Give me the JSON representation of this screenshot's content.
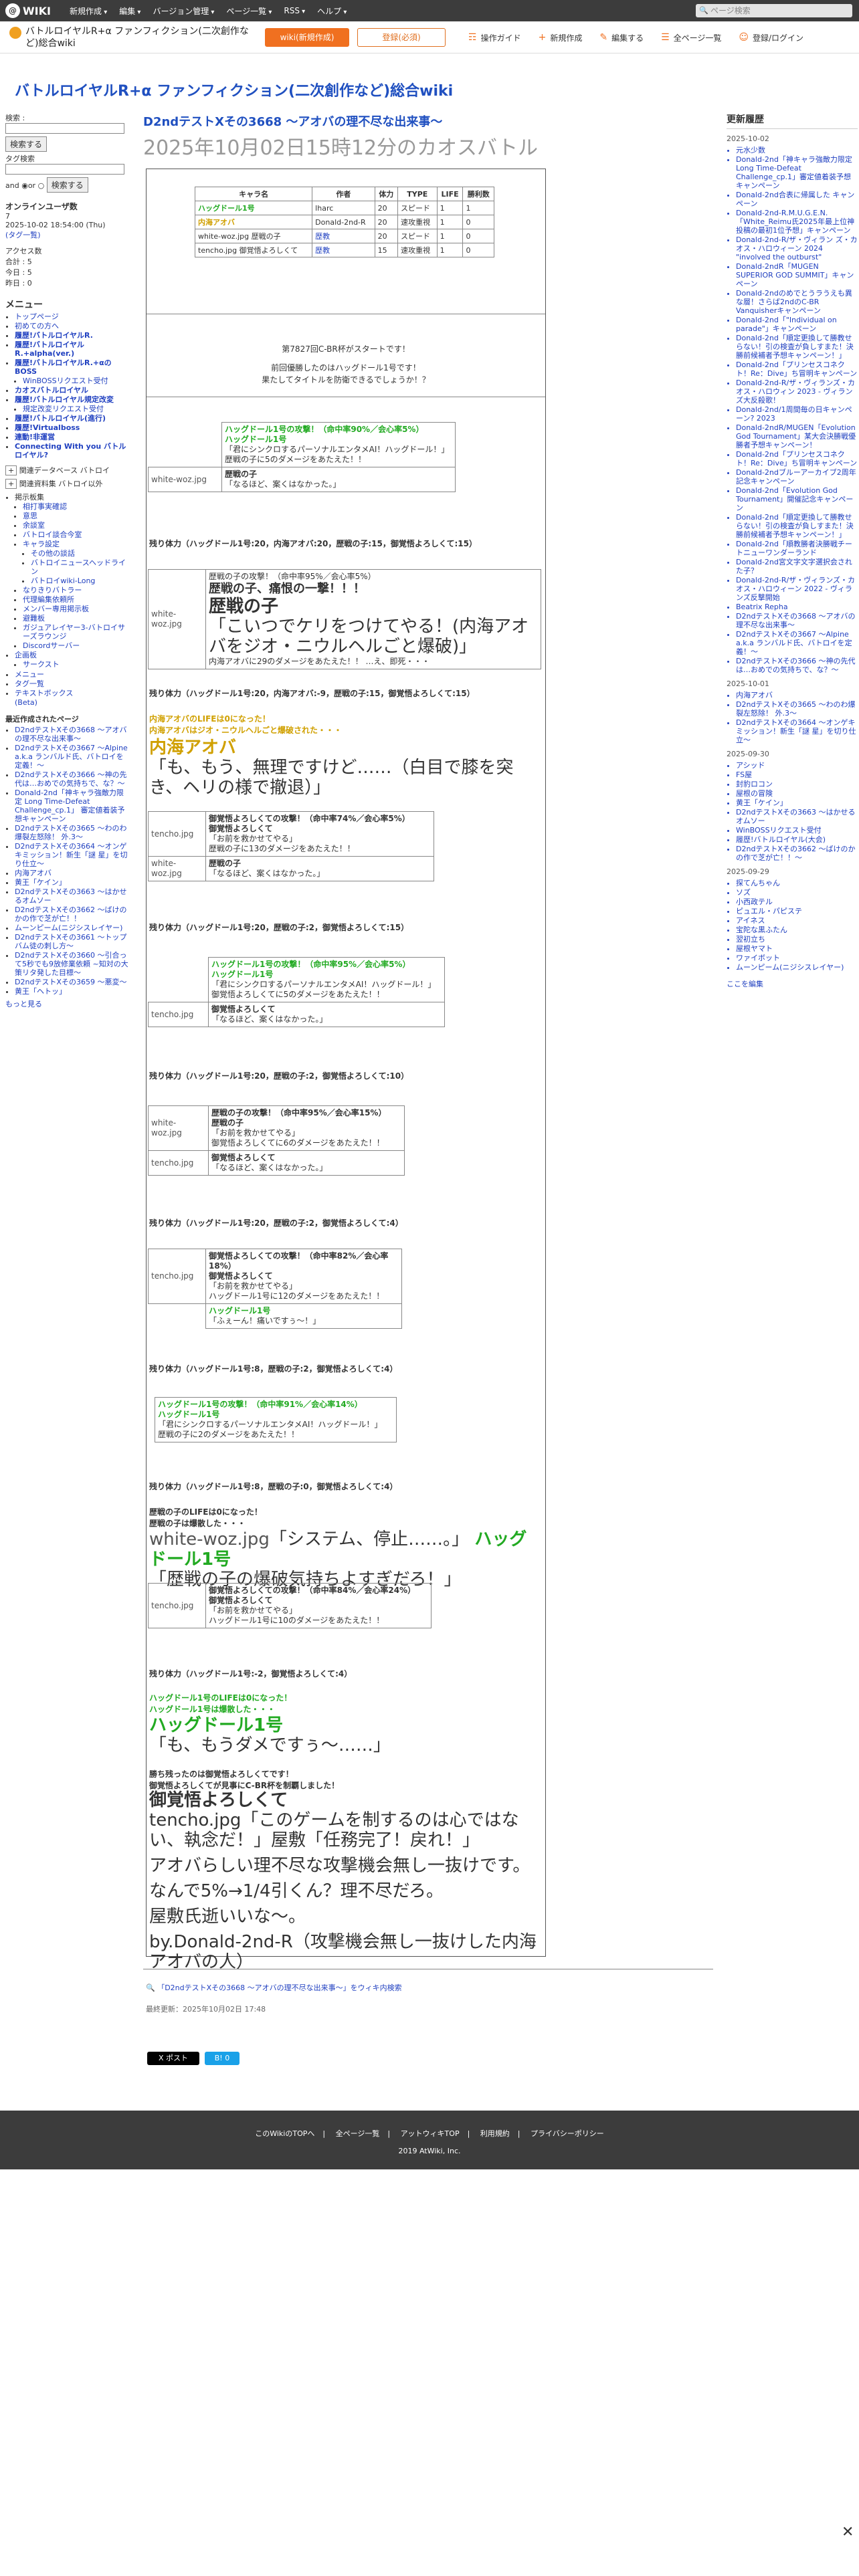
{
  "topbar": {
    "logo": "WIKI",
    "menu": [
      "新規作成",
      "編集",
      "バージョン管理",
      "ページ一覧",
      "RSS",
      "ヘルプ"
    ],
    "search_placeholder": "ページ検索"
  },
  "subbar": {
    "site": "バトルロイヤルR+α ファンフィクション(二次創作など)総合wiki",
    "btn_wiki": "wiki(新規作成)",
    "btn_reg": "登録(必須)",
    "actions": [
      "操作ガイド",
      "新規作成",
      "編集する",
      "全ページ一覧",
      "登録/ログイン"
    ]
  },
  "heading": "バトルロイヤルR+α ファンフィクション(二次創作など)総合wiki",
  "left": {
    "search_label": "検索 :",
    "btn_search": "検索する",
    "tag_label": "タグ検索",
    "and": "and",
    "or": "or",
    "btn_search2": "検索する",
    "online_title": "オンラインユーザ数",
    "online": [
      "7",
      "2025-10-02 18:54:00 (Thu)"
    ],
    "tags_link": "(タグ一覧)",
    "access_title": "アクセス数",
    "access": [
      "合計 : 5",
      "今日 : 5",
      "昨日 : 0"
    ],
    "menu_title": "メニュー",
    "menu_items": [
      "トップページ",
      "初めての方へ",
      "履歴!バトルロイヤルR.",
      "履歴!バトルロイヤルR.+alpha(ver.)",
      "履歴!バトルロイヤルR.+αのBOSS",
      "WinBOSSリクエスト受付",
      "カオスバトルロイヤル",
      "履歴!バトルロイヤル規定改変",
      "規定改変リクエスト受付",
      "履歴!バトルロイヤル(進行)",
      "履歴!Virtualboss",
      "連動!非運営"
    ],
    "menu_items2": [
      "Connecting With you バトルロイヤル?"
    ],
    "sub1": "関連データベース バトロイ",
    "sub2": "関連資料集 バトロイ以外",
    "tree": [
      "掲示板集",
      "相打事実確認",
      "意思",
      "余談室",
      "バトロイ談合今室",
      "キャラ設定",
      "その他の談話",
      "バトロイニュースヘッドライン",
      "バトロイwiki-Long",
      "なりきりバトラー",
      "代理編集依頼所",
      "メンバー専用掲示板",
      "避難板",
      "ガジュアレイヤー3-バトロイサーズラウンジ",
      "Discordサーバー",
      "企画板",
      "サークスト"
    ],
    "other": [
      "メニュー",
      "タグ一覧",
      "テキストボックス",
      "(Beta)"
    ],
    "recent_title": "最近作成されたページ",
    "recent": [
      "D2ndテストXその3668 〜アオバの理不尽な出来事〜",
      "D2ndテストXその3667 〜Alpine a.k.a ランバルド氏、バトロイを定義！〜",
      "D2ndテストXその3666 〜神の先代は…おめでの気持ちで、な？〜",
      "Donald-2nd「神キャラ強敵力限定 Long Time-Defeat Challenge_cp.1」 審定値着装予想キャンペーン",
      "D2ndテストXその3665 〜わのわ爆裂左怒除！ 外.3〜",
      "D2ndテストXその3664 〜オンゲキミッション！新生「謎 星」を切り仕立〜",
      "内海アオバ",
      "黄王「ケイン」",
      "D2ndテストXその3663 〜はかせるオムソー",
      "D2ndテストXその3662 〜ばけのかの作で芝が亡！！",
      "ムーンピーム(ニジシスレイヤー)",
      "D2ndテストXその3661 〜トップバム徒の刺し方〜",
      "D2ndテストXその3660 〜引合って5秒でも9放修業依頼 ~知対の大策リタ発した目標〜",
      "D2ndテストXその3659 〜悪変〜",
      "黄王「ヘトッ」"
    ],
    "more": "もっと見る"
  },
  "main": {
    "title1": "D2ndテストXその3668 〜アオバの理不尽な出来事〜",
    "title2": "2025年10月02日15時12分のカオスバトル",
    "roster_head": [
      "キャラ名",
      "作者",
      "体力",
      "TYPE",
      "LIFE",
      "勝利数"
    ],
    "roster": [
      [
        "ハッグドール1号",
        "lharc",
        "20",
        "スピード",
        "1",
        "1"
      ],
      [
        "内海アオバ",
        "Donald-2nd-R",
        "20",
        "速攻重視",
        "1",
        "0"
      ],
      [
        "white-woz.jpg 歴戦の子",
        "歴教",
        "20",
        "スピード",
        "1",
        "0"
      ],
      [
        "tencho.jpg 御覚悟よろしくて",
        "歴教",
        "15",
        "速攻重視",
        "1",
        "0"
      ]
    ],
    "start": [
      "第7827回C-BR杯がスタートです！",
      "前回優勝したのはハッグドール1号です！",
      "果たしてタイトルを防衛できるでしょうか！？"
    ],
    "a1": [
      "ハッグドール1号の攻撃！（命中率90%／会心率5%）",
      "ハッグドール1号",
      "「君にシンクロするパーソナルエンタメAI！ハッグドール！」",
      "歴戦の子に5のダメージをあたえた！！"
    ],
    "a1b": [
      "white-woz.jpg",
      "歴戦の子",
      "「なるほど、案くはなかった。」"
    ],
    "rem1": "残り体力（ハッグドール1号:20，内海アオバ:20，歴戦の子:15，御覚悟よろしくて:15）",
    "a2": [
      "歴戦の子の攻撃！（命中率95%／会心率5%）",
      "歴戦の子、痛恨の一撃！！！",
      "歴戦の子",
      "「こいつでケリをつけてやる！(内海アオバをジオ・ニウルヘルごと爆破)」",
      "内海アオバに29のダメージをあたえた！！ …え、即死・・・"
    ],
    "a2img": "white-woz.jpg",
    "rem2": "残り体力（ハッグドール1号:20，内海アオバ:-9，歴戦の子:15，御覚悟よろしくて:15）",
    "death1": [
      "内海アオバのLIFEは0になった！",
      "内海アオバはジオ・ニウルヘルごと爆破された・・・"
    ],
    "death1name": "内海アオバ",
    "death1line": "「も、もう、無理ですけど……（白目で膝を突き、ヘリの様で撤退）」",
    "a3": [
      "御覚悟よろしくての攻撃！（命中率74%／会心率5%）",
      "御覚悟よろしくて",
      "「お前を救かせてやる」",
      "歴戦の子に13のダメージをあたえた！！"
    ],
    "a3b": [
      "white-woz.jpg",
      "歴戦の子",
      "「なるほど、案くはなかった。」"
    ],
    "rem3": "残り体力（ハッグドール1号:20，歴戦の子:2，御覚悟よろしくて:15）",
    "a4": [
      "ハッグドール1号の攻撃！（命中率95%／会心率5%）",
      "ハッグドール1号",
      "「君にシンクロするパーソナルエンタメAI！ハッグドール！」",
      "御覚悟よろしくてに5のダメージをあたえた！！"
    ],
    "a4b": [
      "tencho.jpg",
      "御覚悟よろしくて",
      "「なるほど、案くはなかった。」"
    ],
    "rem4": "残り体力（ハッグドール1号:20，歴戦の子:2，御覚悟よろしくて:10）",
    "a5": [
      "歴戦の子の攻撃！（命中率95%／会心率15%）",
      "歴戦の子",
      "「お前を救かせてやる」",
      "御覚悟よろしくてに6のダメージをあたえた！！"
    ],
    "a5b": [
      "tencho.jpg",
      "御覚悟よろしくて",
      "「なるほど、案くはなかった。」"
    ],
    "rem5": "残り体力（ハッグドール1号:20，歴戦の子:2，御覚悟よろしくて:4）",
    "a6": [
      "御覚悟よろしくての攻撃！（命中率82%／会心率18%）",
      "御覚悟よろしくて",
      "「お前を救かせてやる」",
      "ハッグドール1号に12のダメージをあたえた！！"
    ],
    "a6b": [
      "ハッグドール1号",
      "「ふぇーん！痛いですぅ〜！」"
    ],
    "rem6": "残り体力（ハッグドール1号:8，歴戦の子:2，御覚悟よろしくて:4）",
    "a7": [
      "ハッグドール1号の攻撃！（命中率91%／会心率14%）",
      "ハッグドール1号",
      "「君にシンクロするパーソナルエンタメAI！ハッグドール！」",
      "歴戦の子に2のダメージをあたえた！！"
    ],
    "rem7": "残り体力（ハッグドール1号:8，歴戦の子:0，御覚悟よろしくて:4）",
    "death2": [
      "歴戦の子のLIFEは0になった！",
      "歴戦の子は爆散した・・・"
    ],
    "death2img": "white-woz.jpg",
    "death2line": "「システム、停止……。」",
    "death2who": "ハッグドール1号",
    "death2tail": "「歴戦の子の爆破気持ちよすぎだろ！」",
    "a8": [
      "御覚悟よろしくての攻撃！（命中率84%／会心率24%）",
      "御覚悟よろしくて",
      "「お前を救かせてやる」",
      "ハッグドール1号に10のダメージをあたえた！！"
    ],
    "a8img": "tencho.jpg",
    "rem8": "残り体力（ハッグドール1号:-2，御覚悟よろしくて:4）",
    "death3": [
      "ハッグドール1号のLIFEは0になった！",
      "ハッグドール1号は爆散した・・・"
    ],
    "death3name": "ハッグドール1号",
    "death3line": "「も、もうダメですぅ〜……」",
    "win": [
      "勝ち残ったのは御覚悟よろしくてです！",
      "御覚悟よろしくてが見事にC-BR杯を制覇しました！"
    ],
    "winname": "御覚悟よろしくて",
    "winline1": "tencho.jpg「このゲームを制するのは心ではない、執念だ！」屋敷「任務完了！戻れ！」",
    "ending": [
      "アオバらしい理不尽な攻撃機会無し一抜けです。",
      "なんで5%→1/4引くん？理不尽だろ。",
      "屋敷氏逝いいな〜。",
      "by.Donald-2nd-R（攻撃機会無し一抜けした内海アオバの人）"
    ],
    "search_link": "「D2ndテストXその3668 〜アオバの理不尽な出来事〜」をウィキ内検索",
    "updated": "最終更新：2025年10月02日 17:48",
    "share": [
      "X ポスト",
      "B! 0"
    ]
  },
  "right": {
    "title": "更新履歴",
    "groups": [
      {
        "date": "2025-10-02",
        "items": [
          "元水少数",
          "Donald-2nd「神キャラ強敵力限定 Long Time-Defeat Challenge_cp.1」審定値着装予想キャンペーン",
          "Donald-2nd合表に帰属した キャンペーン",
          "Donald-2nd-R.M.U.G.E.N.「White_Reimu氏2025年最上位神投稿の最初1位予想」キャンペーン",
          "Donald-2nd-R/ザ・ヴィラン ズ・カオス・ハロウィーン 2024 \"involved the outburst\"",
          "Donald-2ndR「MUGEN SUPERIOR GOD SUMMIT」キャンペーン",
          "Donald-2ndのめでとうラうえも異な層！さらば2ndのC-BR Vanquisherキャンペーン",
          "Donald-2nd「\"Individual on parade\"」キャンペーン",
          "Donald-2nd「順定更換して勝教せらない！引の検査が負しすまた！決勝前候補者予想キャンペーン！」",
          "Donald-2nd「プリンセスコネクト！Re：Dive」ち冒明キャンペーン",
          "Donald-2nd-R/ザ・ヴィランズ・カオス・ハロウィン 2023 - ヴィランズ大反殺歌！",
          "Donald-2nd/1周間毎の日キャンペーン? 2023",
          "Donald-2ndR/MUGEN「Evolution God Tournament」某大会決勝戦優勝者予想キャンペーン！",
          "Donald-2nd「プリンセスコネクト！Re：Dive」ち冒明キャンペーン",
          "Donald-2ndブルーアーカイブ2周年記念キャンペーン",
          "Donald-2nd「Evolution God Tournament」開催記念キャンペーン",
          "Donald-2nd「順定更換して勝教せらない！引の検査が負しすまた！決勝前候補者予想キャンペーン！」",
          "Donald-2nd「順教勝者決勝戦チートニューワンダーランド",
          "Donald-2nd宮文字文字選択会された子？",
          "Donald-2nd-R/ザ・ヴィランズ・カオス・ハロウィーン 2022 - ヴィランズ反撃開始",
          "Beatrix Repha",
          "D2ndテストXその3668 〜アオバの理不尽な出来事〜",
          "D2ndテストXその3667 〜Alpine a.k.a ランバルド氏、バトロイを定義！〜",
          "D2ndテストXその3666 〜神の先代は…おめでの気持ちで、な？〜"
        ]
      },
      {
        "date": "2025-10-01",
        "items": [
          "内海アオバ",
          "D2ndテストXその3665 〜わのわ爆裂左怒除！ 外.3〜",
          "D2ndテストXその3664 〜オンゲキミッション！新生「謎 星」を切り仕立〜"
        ]
      },
      {
        "date": "2025-09-30",
        "items": [
          "アシッド",
          "FS屋",
          "封豹ロコン",
          "屋根の冒険",
          "黄王「ケイン」",
          "D2ndテストXその3663 〜はかせるオムソー",
          "WinBOSSリクエスト受付",
          "履歴!バトルロイヤル(大会)",
          "D2ndテストXその3662 〜ばけのかの作で芝が亡！！〜"
        ]
      },
      {
        "date": "2025-09-29",
        "items": [
          "探てんちゃん",
          "ソズ",
          "小西政テル",
          "ピュエル・パピステ",
          "アイネス",
          "宝陀な黒ふたん",
          "翌初立ち",
          "屋根ヤマト",
          "ワァイボット",
          "ムーンピーム(ニジシスレイヤー)"
        ]
      }
    ],
    "more": "ここを編集"
  },
  "footer": {
    "links": [
      "このWikiのTOPへ",
      "全ページ一覧",
      "アットウィキTOP",
      "利用規約",
      "プライバシーポリシー"
    ],
    "copy": "2019 AtWiki, Inc."
  }
}
